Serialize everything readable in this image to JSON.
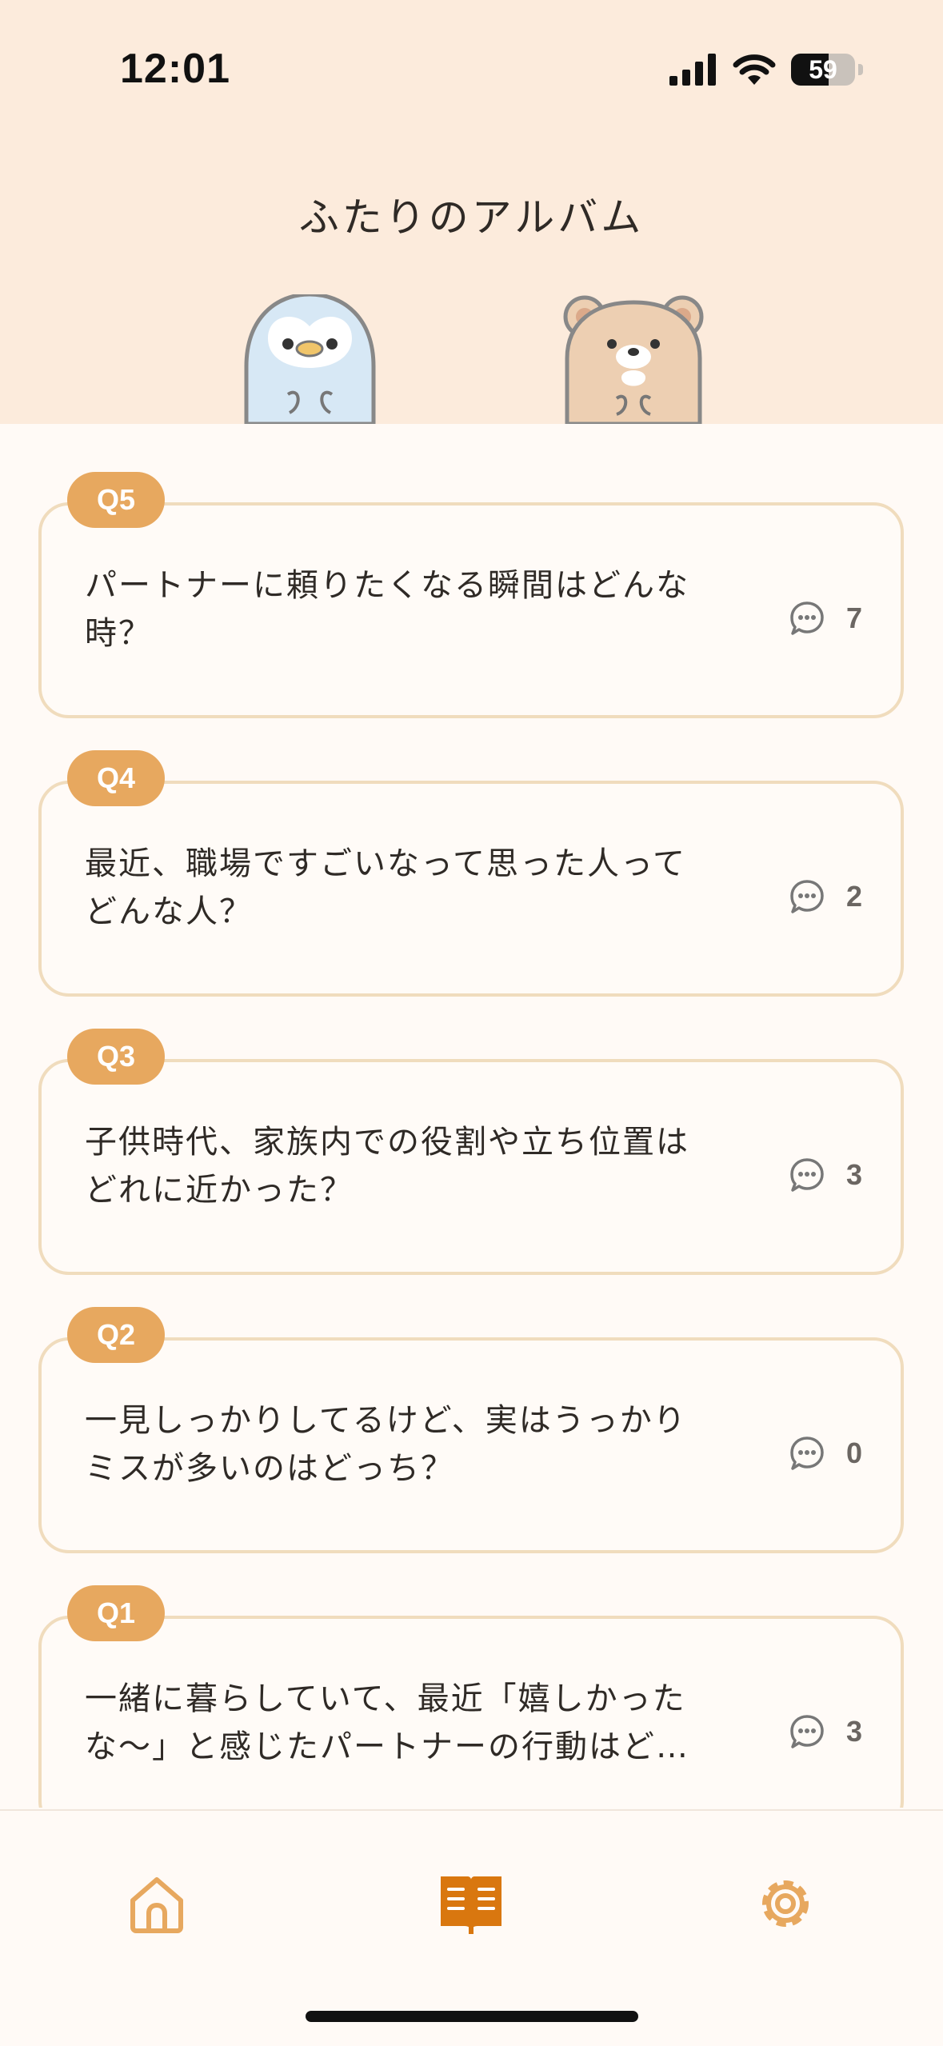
{
  "status_bar": {
    "time": "12:01",
    "battery": "59"
  },
  "header": {
    "title": "ふたりのアルバム"
  },
  "questions": [
    {
      "badge": "Q5",
      "line1": "パートナーに頼りたくなる瞬間はどんな",
      "line2": "時？",
      "comments": "7"
    },
    {
      "badge": "Q4",
      "line1": "最近、職場ですごいなって思った人って",
      "line2": "どんな人？",
      "comments": "2"
    },
    {
      "badge": "Q3",
      "line1": "子供時代、家族内での役割や立ち位置は",
      "line2": "どれに近かった？",
      "comments": "3"
    },
    {
      "badge": "Q2",
      "line1": "一見しっかりしてるけど、実はうっかり",
      "line2": "ミスが多いのはどっち？",
      "comments": "0"
    },
    {
      "badge": "Q1",
      "line1": "一緒に暮らしていて、最近「嬉しかった",
      "line2": "な〜」と感じたパートナーの行動はど…",
      "comments": "3"
    }
  ],
  "tabs": [
    {
      "name": "home",
      "icon": "home-icon",
      "active": false
    },
    {
      "name": "album",
      "icon": "book-icon",
      "active": true
    },
    {
      "name": "settings",
      "icon": "gear-icon",
      "active": false
    }
  ],
  "colors": {
    "accent": "#e7a85f",
    "active_tab": "#d9770f",
    "card_border": "#f0dcbd",
    "header_bg": "#fcebdc"
  }
}
